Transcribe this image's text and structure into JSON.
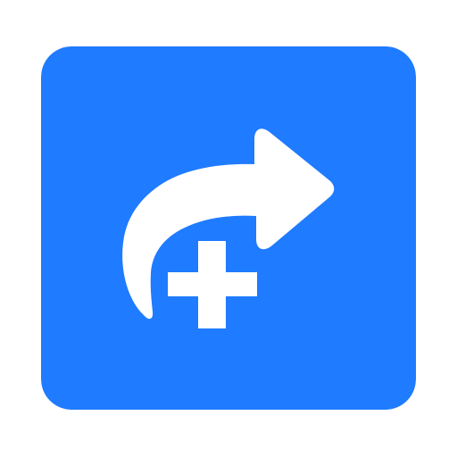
{
  "icon": {
    "name": "share-add-icon",
    "glyphs": [
      "forward-arrow-icon",
      "plus-icon"
    ],
    "colors": {
      "background": "#1F7BFF",
      "foreground": "#FFFFFF",
      "page": "#FFFFFF"
    }
  }
}
